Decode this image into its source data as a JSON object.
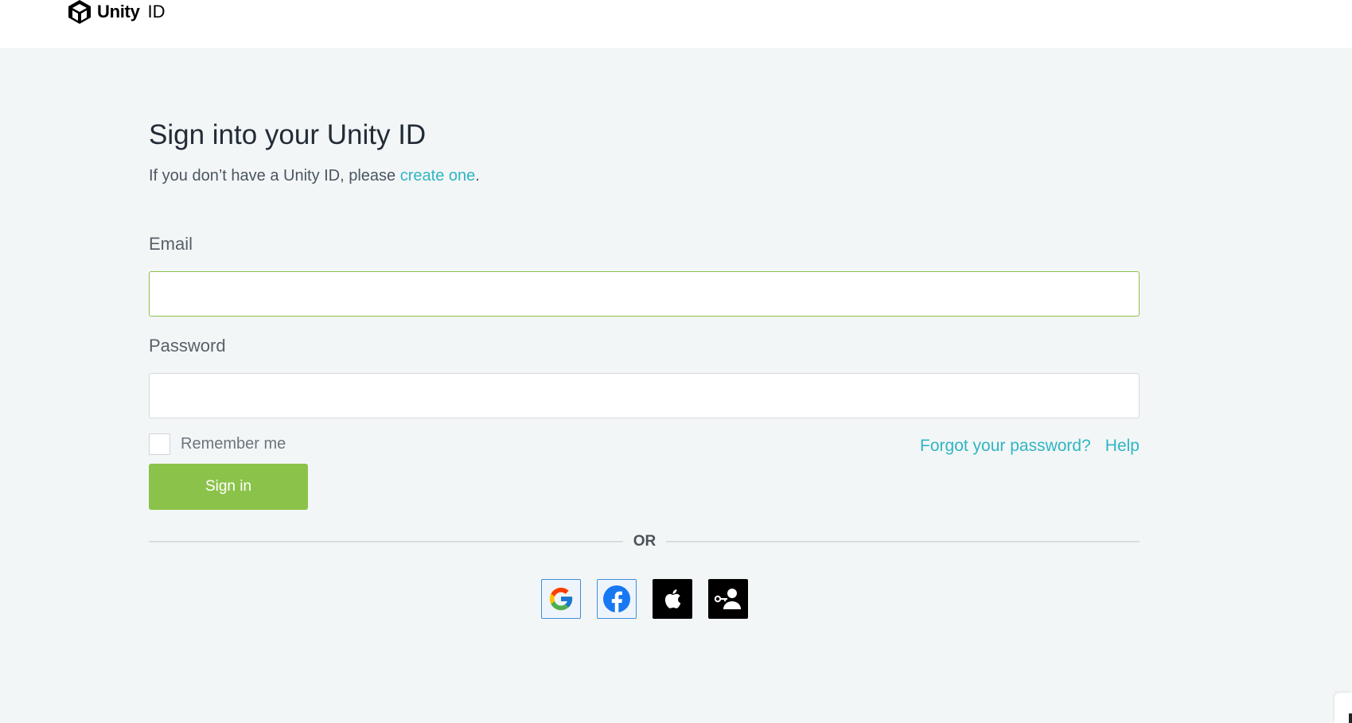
{
  "header": {
    "logo_word": "Unity",
    "logo_suffix": "ID"
  },
  "signin": {
    "title": "Sign into your Unity ID",
    "subtitle_prefix": "If you don’t have a Unity ID, please ",
    "create_link": "create one",
    "subtitle_suffix": ".",
    "email_label": "Email",
    "email_value": "",
    "password_label": "Password",
    "password_value": "",
    "remember_label": "Remember me",
    "remember_checked": false,
    "forgot_link": "Forgot your password?",
    "help_link": "Help",
    "submit_label": "Sign in",
    "or_label": "OR"
  },
  "social": [
    {
      "icon": "google-icon"
    },
    {
      "icon": "facebook-icon"
    },
    {
      "icon": "apple-icon"
    },
    {
      "icon": "sso-icon"
    }
  ],
  "colors": {
    "accent_green": "#8bc34a",
    "link_teal": "#2fb5c4",
    "page_background": "#f3f6f6"
  }
}
